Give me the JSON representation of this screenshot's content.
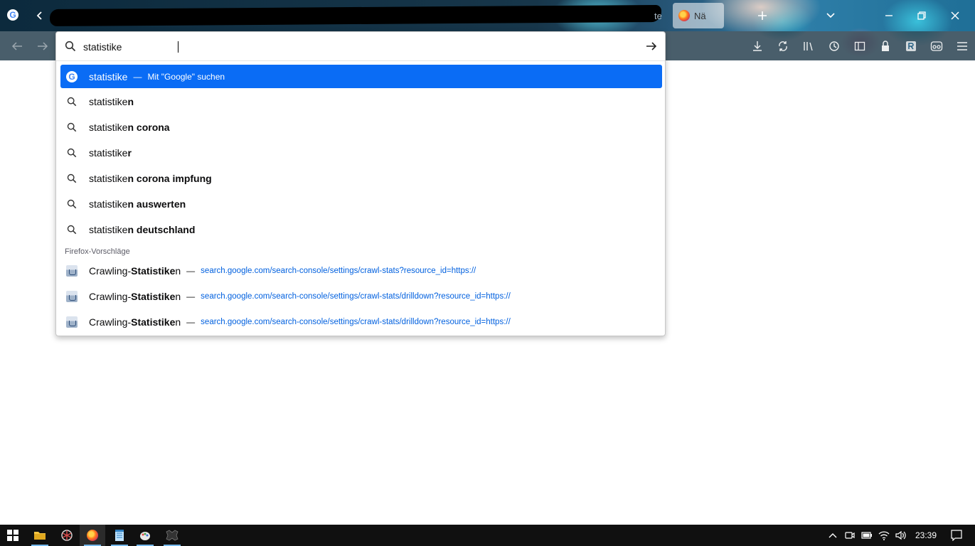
{
  "tabstrip": {
    "tab_hint": "te",
    "active_tab_title": "Nä"
  },
  "url_bar": {
    "value": "statistike"
  },
  "suggestions": {
    "selected": {
      "text": "statistike",
      "separator": "—",
      "action": "Mit \"Google\" suchen"
    },
    "search_items": [
      {
        "typed": "statistike",
        "completion": "n"
      },
      {
        "typed": "statistike",
        "completion": "n corona"
      },
      {
        "typed": "statistike",
        "completion": "r"
      },
      {
        "typed": "statistike",
        "completion": "n corona impfung"
      },
      {
        "typed": "statistike",
        "completion": "n auswerten"
      },
      {
        "typed": "statistike",
        "completion": "n deutschland"
      }
    ],
    "section_label": "Firefox-Vorschläge",
    "firefox_items": [
      {
        "prefix": "Crawling-",
        "match": "Statistike",
        "suffix": "n",
        "separator": "—",
        "url": "search.google.com/search-console/settings/crawl-stats?resource_id=https://"
      },
      {
        "prefix": "Crawling-",
        "match": "Statistike",
        "suffix": "n",
        "separator": "—",
        "url": "search.google.com/search-console/settings/crawl-stats/drilldown?resource_id=https://"
      },
      {
        "prefix": "Crawling-",
        "match": "Statistike",
        "suffix": "n",
        "separator": "—",
        "url": "search.google.com/search-console/settings/crawl-stats/drilldown?resource_id=https://"
      }
    ]
  },
  "taskbar": {
    "clock": "23:39"
  },
  "colors": {
    "selected_row": "#0a6cf5",
    "url_text": "#0060df",
    "taskbar": "#101010"
  }
}
